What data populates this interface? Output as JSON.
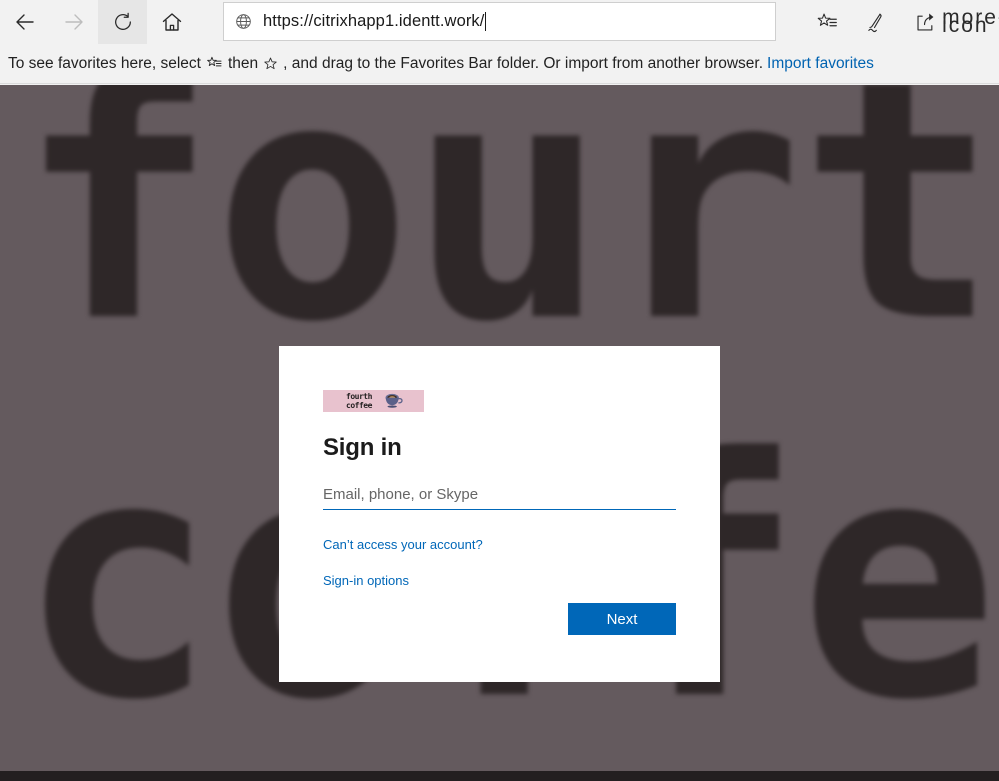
{
  "browser": {
    "nav": {
      "back_label": "Back",
      "forward_label": "Forward",
      "refresh_label": "Refresh",
      "home_label": "Home"
    },
    "address": {
      "url": "https://citrixhapp1.identt.work/",
      "site_icon": "globe-icon"
    },
    "actions": [
      {
        "name": "favorites-icon",
        "label": "Favorites"
      },
      {
        "name": "notes-pen-icon",
        "label": "Make a Web Note"
      },
      {
        "name": "share-icon",
        "label": "Share"
      },
      {
        "name": "more-icon",
        "label": "···"
      }
    ],
    "favorites_bar": {
      "text_part1": "To see favorites here, select",
      "text_part2": "then",
      "text_part3": ", and drag to the Favorites Bar folder. Or import from another browser.",
      "import_link": "Import favorites"
    }
  },
  "page_background": {
    "word_top": "fourth",
    "word_bottom": "coffee",
    "bg_color": "#645a5e",
    "text_color": "#2e2728",
    "footer_bar_color": "#231f20"
  },
  "signin": {
    "logo": {
      "line1": "fourth",
      "line2": "coffee",
      "background_color": "#e8c2ce",
      "icon": "coffee-cup-icon"
    },
    "title": "Sign in",
    "email_field": {
      "placeholder": "Email, phone, or Skype",
      "value": ""
    },
    "links": [
      {
        "name": "cant-access-account-link",
        "label": "Can’t access your account?"
      },
      {
        "name": "sign-in-options-link",
        "label": "Sign-in options"
      }
    ],
    "next_button": "Next",
    "accent_color": "#0067b8"
  }
}
